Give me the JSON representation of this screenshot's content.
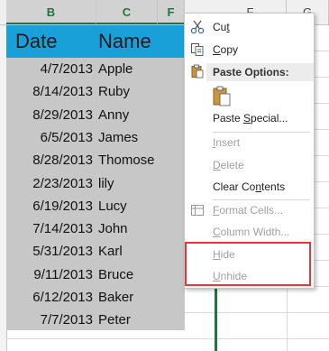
{
  "columns": {
    "B": "B",
    "C": "C",
    "D": "F",
    "E": "F",
    "G": "G"
  },
  "table": {
    "headers": {
      "date": "Date",
      "name": "Name"
    },
    "rows": [
      {
        "date": "4/7/2013",
        "name": "Apple"
      },
      {
        "date": "8/14/2013",
        "name": "Ruby"
      },
      {
        "date": "8/29/2013",
        "name": "Anny"
      },
      {
        "date": "6/5/2013",
        "name": "James"
      },
      {
        "date": "8/28/2013",
        "name": "Thomose"
      },
      {
        "date": "2/23/2013",
        "name": "lily"
      },
      {
        "date": "6/19/2013",
        "name": "Lucy"
      },
      {
        "date": "7/14/2013",
        "name": "John"
      },
      {
        "date": "5/31/2013",
        "name": "Karl"
      },
      {
        "date": "9/11/2013",
        "name": "Bruce"
      },
      {
        "date": "6/12/2013",
        "name": "Baker"
      },
      {
        "date": "7/7/2013",
        "name": "Peter"
      }
    ]
  },
  "context_menu": {
    "cut": {
      "pre": "Cu",
      "ul": "t",
      "post": "",
      "icon": "scissors-icon"
    },
    "copy": {
      "pre": "",
      "ul": "C",
      "post": "opy",
      "icon": "copy-icon"
    },
    "paste_options": {
      "label": "Paste Options:",
      "icon": "paste-icon"
    },
    "paste_special": {
      "pre": "Paste ",
      "ul": "S",
      "post": "pecial..."
    },
    "insert": {
      "pre": "",
      "ul": "I",
      "post": "nsert"
    },
    "delete": {
      "pre": "",
      "ul": "D",
      "post": "elete"
    },
    "clear_contents": {
      "pre": "Clear Co",
      "ul": "n",
      "post": "tents"
    },
    "format_cells": {
      "pre": "",
      "ul": "F",
      "post": "ormat Cells...",
      "icon": "format-cells-icon"
    },
    "column_width": {
      "pre": "",
      "ul": "C",
      "post": "olumn Width..."
    },
    "hide": {
      "pre": "",
      "ul": "H",
      "post": "ide"
    },
    "unhide": {
      "pre": "",
      "ul": "U",
      "post": "nhide"
    }
  },
  "colors": {
    "header_fill": "#1aa0d8",
    "selection_fill": "#c7c7c7",
    "highlight_border": "#e0393a",
    "excel_green": "#217346"
  }
}
